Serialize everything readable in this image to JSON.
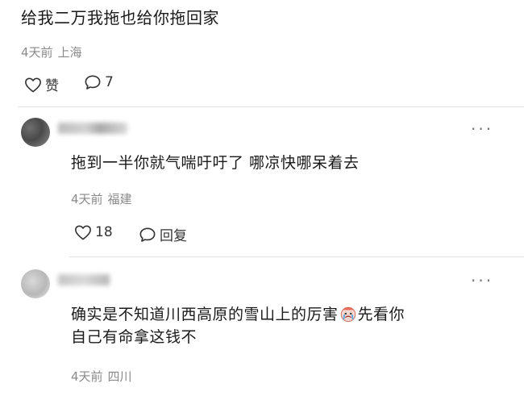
{
  "post": {
    "text": "给我二万我拖也给你拖回家",
    "time": "4天前",
    "location": "上海",
    "like_label": "赞",
    "comment_count": "7"
  },
  "replies": [
    {
      "text": "拖到一半你就气喘吁吁了  哪凉快哪呆着去",
      "time": "4天前",
      "location": "福建",
      "like_count": "18",
      "reply_label": "回复"
    },
    {
      "text_line1_a": "确实是不知道川西高原的雪山上的厉害",
      "text_line1_b": "先看你",
      "text_line2": "自己有命拿这钱不",
      "emoji": "crying-face",
      "time": "4天前",
      "location": "四川"
    }
  ],
  "icons": {
    "like": "heart-icon",
    "comment": "speech-bubble-icon",
    "more": "ellipsis-icon"
  }
}
